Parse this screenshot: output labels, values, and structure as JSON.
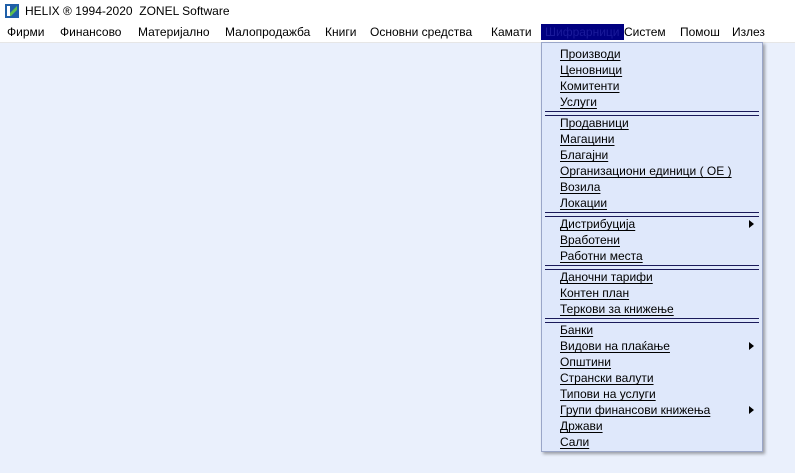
{
  "titlebar": {
    "title": "HELIX ® 1994-2020  ZONEL Software"
  },
  "menubar": {
    "items": [
      {
        "label": "Фирми"
      },
      {
        "label": "Финансово"
      },
      {
        "label": "Материјално"
      },
      {
        "label": "Малопродажба"
      },
      {
        "label": "Книги"
      },
      {
        "label": "Основни средства"
      },
      {
        "label": "Камати"
      },
      {
        "label": "Шифрарници"
      },
      {
        "label": "Систем"
      },
      {
        "label": "Помош"
      },
      {
        "label": "Излез"
      }
    ]
  },
  "dropdown": {
    "items": [
      {
        "label": "Производи"
      },
      {
        "label": "Ценовници"
      },
      {
        "label": "Комитенти"
      },
      {
        "label": "Услуги"
      },
      {
        "label": "Продавници"
      },
      {
        "label": "Магацини"
      },
      {
        "label": "Благајни"
      },
      {
        "label": "Организациони единици ( ОЕ )"
      },
      {
        "label": "Возила"
      },
      {
        "label": "Локации"
      },
      {
        "label": "Дистрибуција"
      },
      {
        "label": "Вработени"
      },
      {
        "label": "Работни места"
      },
      {
        "label": "Даночни тарифи"
      },
      {
        "label": "Контен план"
      },
      {
        "label": "Теркови за книжење"
      },
      {
        "label": "Банки"
      },
      {
        "label": "Видови на плаќање"
      },
      {
        "label": "Општини"
      },
      {
        "label": "Странски валути"
      },
      {
        "label": "Типови на услуги"
      },
      {
        "label": "Групи финансови книжења"
      },
      {
        "label": "Држави"
      },
      {
        "label": "Сали"
      }
    ]
  }
}
